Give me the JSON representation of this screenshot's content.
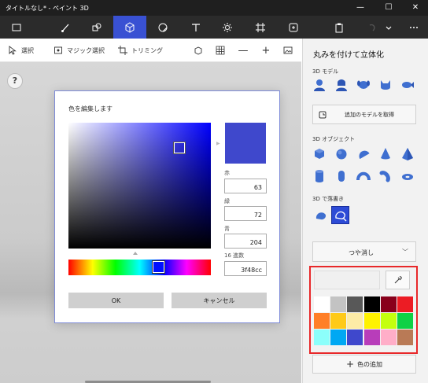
{
  "window": {
    "title": "タイトルなし* - ペイント 3D",
    "minimize": "—",
    "maximize": "☐",
    "close": "✕"
  },
  "menubar": {
    "tools": [
      {
        "icon": "menu-folder-icon"
      },
      {
        "icon": "brush-icon"
      },
      {
        "icon": "2d-shapes-icon"
      },
      {
        "icon": "3d-shapes-icon",
        "active": true
      },
      {
        "icon": "stickers-icon"
      },
      {
        "icon": "text-icon"
      },
      {
        "icon": "effects-icon"
      },
      {
        "icon": "canvas-icon"
      },
      {
        "icon": "remix3d-icon"
      },
      {
        "icon": "paste-icon"
      },
      {
        "icon": "undo-icon"
      },
      {
        "icon": "more-icon"
      },
      {
        "icon": "more-options-icon"
      }
    ]
  },
  "toolbar": {
    "select": "選択",
    "magic_select": "マジック選択",
    "crop": "トリミング",
    "minus": "—",
    "plus": "+"
  },
  "canvas": {
    "help": "?"
  },
  "color_dialog": {
    "title": "色を編集します",
    "red_label": "赤",
    "red_value": "63",
    "green_label": "緑",
    "green_value": "72",
    "blue_label": "青",
    "blue_value": "204",
    "hex_label": "16 進数",
    "hex_value": "3f48cc",
    "ok": "OK",
    "cancel": "キャンセル",
    "preview_color": "#3f48cc"
  },
  "right_panel": {
    "title": "丸みを付けて立体化",
    "models_label": "3D モデル",
    "get_models": "追加のモデルを取得",
    "objects_label": "3D オブジェクト",
    "doodle_label": "3D で落書き",
    "finish": "つや消し",
    "add_color": "色の追加",
    "accent_color": "#2d4bd6",
    "highlight_color": "#e8282a"
  },
  "palette": {
    "colors": [
      "#ffffff",
      "#c3c3c3",
      "#585858",
      "#000000",
      "#88001b",
      "#ec1c24",
      "#ff7f27",
      "#ffca18",
      "#fdeca6",
      "#fff200",
      "#c4ff0e",
      "#0ed145",
      "#8cfffb",
      "#00a8f3",
      "#3f48cc",
      "#b83dba",
      "#ffaec8",
      "#b97a56"
    ]
  }
}
